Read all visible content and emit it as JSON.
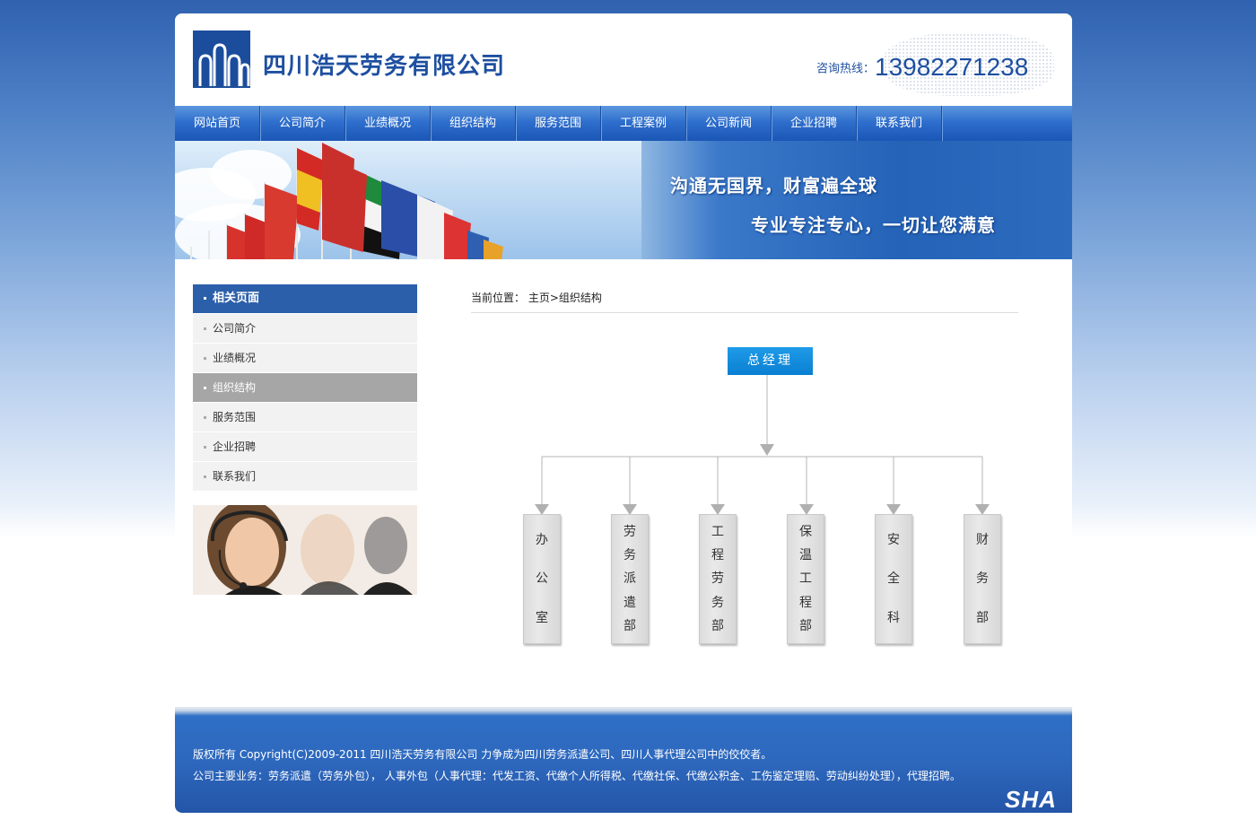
{
  "header": {
    "company_name": "四川浩天劳务有限公司",
    "hotline_label": "咨询热线：",
    "hotline_number": "13982271238"
  },
  "nav": {
    "items": [
      "网站首页",
      "公司简介",
      "业绩概况",
      "组织结构",
      "服务范围",
      "工程案例",
      "公司新闻",
      "企业招聘",
      "联系我们"
    ]
  },
  "banner": {
    "slogan1": "沟通无国界，财富遍全球",
    "slogan2": "专业专注专心，一切让您满意"
  },
  "sidebar": {
    "heading": "相关页面",
    "items": [
      "公司简介",
      "业绩概况",
      "组织结构",
      "服务范围",
      "企业招聘",
      "联系我们"
    ],
    "active": "组织结构"
  },
  "breadcrumb": {
    "label": "当前位置：",
    "home": "主页",
    "separator": ">",
    "current": "组织结构"
  },
  "org_chart": {
    "top": "总经理",
    "departments": [
      [
        "办",
        "公",
        "室"
      ],
      [
        "劳",
        "务",
        "派",
        "遣",
        "部"
      ],
      [
        "工",
        "程",
        "劳",
        "务",
        "部"
      ],
      [
        "保",
        "温",
        "工",
        "程",
        "部"
      ],
      [
        "安",
        "全",
        "科"
      ],
      [
        "财",
        "务",
        "部"
      ]
    ]
  },
  "footer": {
    "line1": "版权所有 Copyright(C)2009-2011 四川浩天劳务有限公司 力争成为四川劳务派遣公司、四川人事代理公司中的佼佼者。",
    "line2": "公司主要业务：劳务派遣（劳务外包）， 人事外包（人事代理：代发工资、代缴个人所得税、代缴社保、代缴公积金、工伤鉴定理赔、劳动纠纷处理），代理招聘。",
    "mark": "SHA"
  },
  "colors": {
    "brand_blue": "#1e4fa0",
    "nav_blue": "#2f6fcd",
    "sidebar_head": "#2b5faa",
    "sidebar_active": "#a6a6a6",
    "org_top": "#0a7fd1"
  }
}
